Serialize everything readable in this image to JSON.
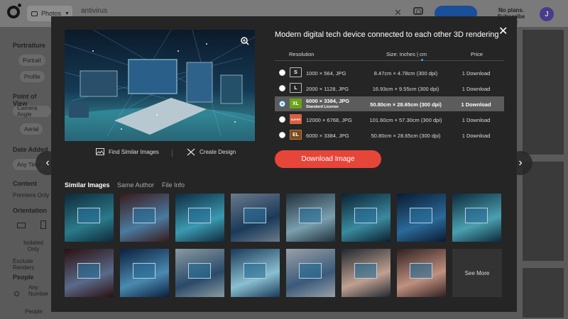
{
  "header": {
    "search_type_label": "Photos",
    "search_query": "antivirus",
    "plan_notice": "No plans. Subscribe now!",
    "avatar_letter": "J"
  },
  "sidebar": {
    "portraiture_heading": "Portraiture",
    "portrait_label": "Portrait",
    "profile_label": "Profile",
    "point_of_view_heading": "Point of View",
    "camera_angle_label": "Camera Angle",
    "aerial_label": "Aerial",
    "date_added_heading": "Date Added",
    "any_time_label": "Any Time",
    "content_heading": "Content",
    "premiere_only_label": "Premiere Only",
    "orientation_heading": "Orientation",
    "isolated_only_label": "Isolated Only",
    "exclude_renders_label": "Exclude Renders",
    "people_heading": "People",
    "any_number_label": "Any Number",
    "people_label": "People"
  },
  "modal": {
    "title": "Modern digital tech device connected to each other 3D rendering",
    "find_similar_label": "Find Similar Images",
    "create_design_label": "Create Design",
    "table_headers": {
      "resolution": "Resolution",
      "size": "Size: Inches | cm",
      "price": "Price"
    },
    "sizes": [
      {
        "badge": "S",
        "resolution": "1000 × 564, JPG",
        "dimensions": "8.47cm × 4.78cm (300 dpi)",
        "price": "1 Download"
      },
      {
        "badge": "L",
        "resolution": "2000 × 1128, JPG",
        "dimensions": "16.93cm × 9.55cm (300 dpi)",
        "price": "1 Download"
      },
      {
        "badge": "XL",
        "resolution": "6000 × 3384, JPG",
        "license": "Standard License",
        "dimensions": "50.80cm × 28.65cm (300 dpi)",
        "price": "1 Download"
      },
      {
        "badge": "SUPER",
        "resolution": "12000 × 6768, JPG",
        "dimensions": "101.60cm × 57.30cm (300 dpi)",
        "price": "1 Download"
      },
      {
        "badge": "EL",
        "resolution": "6000 × 3384, JPG",
        "dimensions": "50.80cm × 28.65cm (300 dpi)",
        "price": "1 Download"
      }
    ],
    "selected_size": "XL",
    "download_label": "Download Image",
    "tabs": [
      "Similar Images",
      "Same Author",
      "File Info"
    ],
    "active_tab": "Similar Images",
    "see_more_label": "See More"
  },
  "colors": {
    "accent": "#e6453a",
    "selected_radio": "#3aa0e0",
    "xl_badge": "#6aa318",
    "modal_bg": "#252525"
  }
}
